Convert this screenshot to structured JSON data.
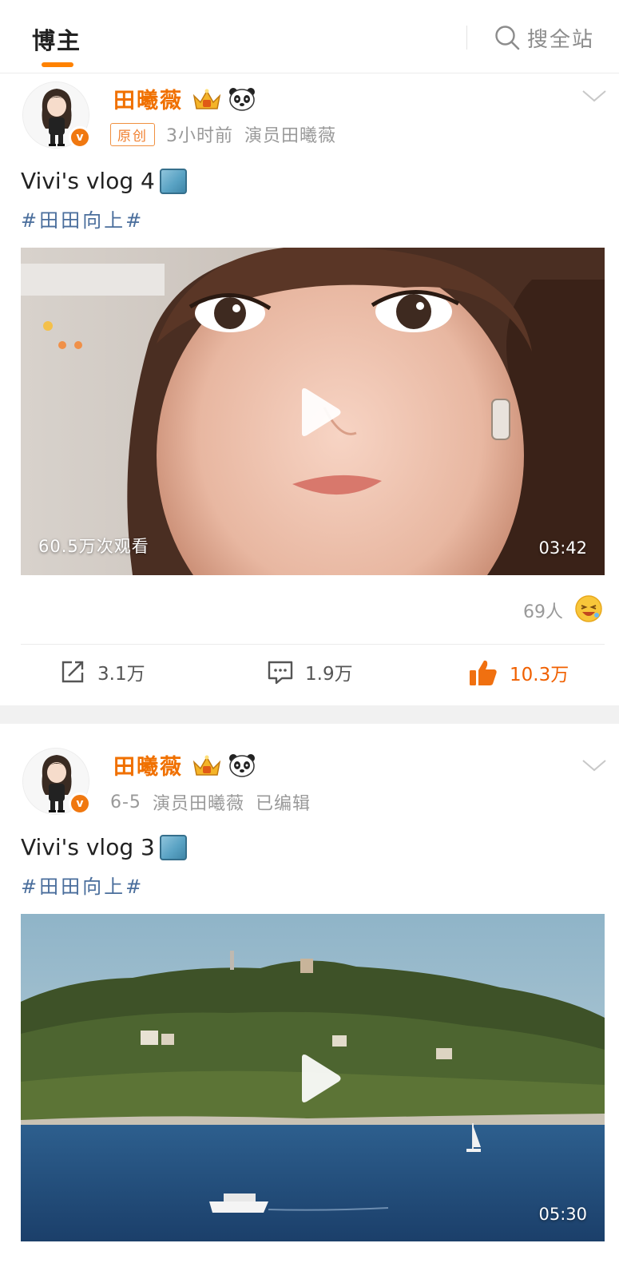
{
  "header": {
    "tab_blogger": "博主",
    "search_label": "搜全站"
  },
  "colors": {
    "accent": "#ff8200",
    "username": "#f07000",
    "hashtag": "#4a6e9c",
    "like": "#f06000"
  },
  "posts": [
    {
      "username": "田曦薇",
      "badges": [
        "crown-icon",
        "panda-icon"
      ],
      "original_tag": "原创",
      "time": "3小时前",
      "source": "演员田曦薇",
      "title": "Vivi's vlog 4",
      "hashtag": "#田田向上#",
      "video": {
        "views": "60.5万次观看",
        "duration": "03:42"
      },
      "reactions": {
        "count": "69人"
      },
      "actions": {
        "share": "3.1万",
        "comment": "1.9万",
        "like": "10.3万"
      }
    },
    {
      "username": "田曦薇",
      "badges": [
        "crown-icon",
        "panda-icon"
      ],
      "time": "6-5",
      "source": "演员田曦薇",
      "edited": "已编辑",
      "title": "Vivi's vlog 3",
      "hashtag": "#田田向上#",
      "video": {
        "duration": "05:30"
      }
    }
  ]
}
